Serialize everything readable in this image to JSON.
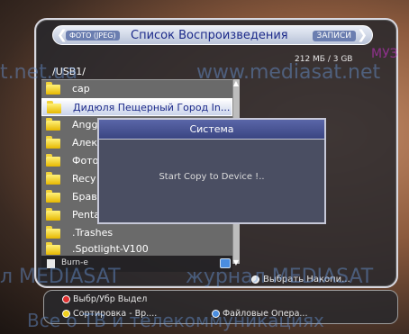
{
  "header": {
    "left_tab": "ФОТО (JPEG)",
    "title": "Список Воспроизведения",
    "right_tab": "ЗАПИСИ"
  },
  "storage_info": "212 МБ / 3 GB",
  "path": "/USB1/",
  "files": [
    {
      "name": "cap",
      "selected": false
    },
    {
      "name": "Дидюля Пещерный Город In...",
      "selected": true
    },
    {
      "name": "Angg",
      "selected": false
    },
    {
      "name": "Алек",
      "selected": false
    },
    {
      "name": "Фото",
      "selected": false
    },
    {
      "name": "Recy",
      "selected": false
    },
    {
      "name": "Браво",
      "selected": false
    },
    {
      "name": "Penta",
      "selected": false
    },
    {
      "name": ".Trashes",
      "selected": false
    },
    {
      "name": ".Spotlight-V100",
      "selected": false
    }
  ],
  "burn": {
    "label": "Burn-e"
  },
  "select_storage": "Выбрать Накопи...",
  "dialog": {
    "title": "Система",
    "message": "Start Copy to Device !.."
  },
  "footer": {
    "hint1": "Выбр/Убр Выдел",
    "hint2": "Сортировка - Вр....",
    "hint3": "Файловые Опера..."
  },
  "watermarks": {
    "url_left": "t.net.ua",
    "url_right": "www.mediasat.net",
    "brand_left": "л MEDIASAT",
    "brand_right": "журнал MEDIASAT",
    "tagline": "Все о ТВ и телекоммуникациях",
    "corner": "МУЗ"
  },
  "colors": {
    "accent_blue": "#1c2a8a",
    "folder_yellow": "#f2d33a",
    "red_button": "#e03030",
    "yellow_button": "#f0d020",
    "blue_button": "#4a8de0"
  }
}
